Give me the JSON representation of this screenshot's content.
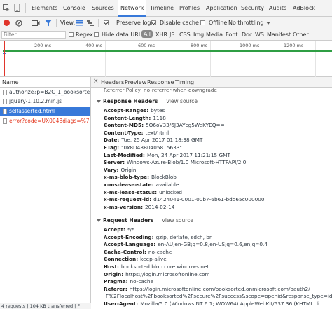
{
  "tabs": [
    {
      "label": "Elements"
    },
    {
      "label": "Console"
    },
    {
      "label": "Sources"
    },
    {
      "label": "Network"
    },
    {
      "label": "Timeline"
    },
    {
      "label": "Profiles"
    },
    {
      "label": "Application"
    },
    {
      "label": "Security"
    },
    {
      "label": "Audits"
    },
    {
      "label": "AdBlock"
    }
  ],
  "controls": {
    "view_label": "View:",
    "preserve_log": "Preserve log",
    "disable_cache": "Disable cache",
    "offline": "Offline",
    "throttling": "No throttling"
  },
  "filter": {
    "placeholder": "Filter",
    "regex": "Regex",
    "hide_data_urls": "Hide data URLs",
    "types": [
      "All",
      "XHR",
      "JS",
      "CSS",
      "Img",
      "Media",
      "Font",
      "Doc",
      "WS",
      "Manifest",
      "Other"
    ]
  },
  "timeline": {
    "ticks": [
      "200 ms",
      "400 ms",
      "600 ms",
      "800 ms",
      "1000 ms",
      "1200 ms"
    ]
  },
  "requests": {
    "header": "Name",
    "items": [
      {
        "name": "authorize?p=B2C_1_booksortedA..."
      },
      {
        "name": "jquery-1.10.2.min.js"
      },
      {
        "name": "selfasserted.html"
      },
      {
        "name": "error?code=UX0048diags=%7B%..."
      }
    ],
    "status": "4 requests | 104 KB transferred | F"
  },
  "detail_tabs": [
    "Headers",
    "Preview",
    "Response",
    "Timing"
  ],
  "referrer_line": "Referrer Policy: no-referrer-when-downgrade",
  "response_headers": {
    "title": "Response Headers",
    "view_source": "view source",
    "rows": [
      {
        "k": "Accept-Ranges:",
        "v": "bytes"
      },
      {
        "k": "Content-Length:",
        "v": "1118"
      },
      {
        "k": "Content-MD5:",
        "v": "5O6oV33/6J3AYcg5WeKYEQ=="
      },
      {
        "k": "Content-Type:",
        "v": "text/html"
      },
      {
        "k": "Date:",
        "v": "Tue, 25 Apr 2017 01:18:38 GMT"
      },
      {
        "k": "ETag:",
        "v": "\"0x8D48B0405815633\""
      },
      {
        "k": "Last-Modified:",
        "v": "Mon, 24 Apr 2017 11:21:15 GMT"
      },
      {
        "k": "Server:",
        "v": "Windows-Azure-Blob/1.0 Microsoft-HTTPAPI/2.0"
      },
      {
        "k": "Vary:",
        "v": "Origin"
      },
      {
        "k": "x-ms-blob-type:",
        "v": "BlockBlob"
      },
      {
        "k": "x-ms-lease-state:",
        "v": "available"
      },
      {
        "k": "x-ms-lease-status:",
        "v": "unlocked"
      },
      {
        "k": "x-ms-request-id:",
        "v": "d1424041-0001-00b7-6b61-bdd65c000000"
      },
      {
        "k": "x-ms-version:",
        "v": "2014-02-14"
      }
    ]
  },
  "request_headers": {
    "title": "Request Headers",
    "view_source": "view source",
    "rows": [
      {
        "k": "Accept:",
        "v": "*/*"
      },
      {
        "k": "Accept-Encoding:",
        "v": "gzip, deflate, sdch, br"
      },
      {
        "k": "Accept-Language:",
        "v": "en-AU,en-GB;q=0.8,en-US;q=0.6,en;q=0.4"
      },
      {
        "k": "Cache-Control:",
        "v": "no-cache"
      },
      {
        "k": "Connection:",
        "v": "keep-alive"
      },
      {
        "k": "Host:",
        "v": "booksorted.blob.core.windows.net"
      },
      {
        "k": "Origin:",
        "v": "https://login.microsoftonline.com"
      },
      {
        "k": "Pragma:",
        "v": "no-cache"
      },
      {
        "k": "Referer:",
        "v": "https://login.microsoftonline.com/booksorted.onmicrosoft.com/oauth2/"
      },
      {
        "k": "",
        "v": "F%2Flocalhost%2Fbooksorted%2Fsecure%2Fsuccess&scope=openid&response_type=id_t"
      },
      {
        "k": "User-Agent:",
        "v": "Mozilla/5.0 (Windows NT 6.1; WOW64) AppleWebKit/537.36 (KHTML, li"
      }
    ]
  },
  "colors": {
    "accent": "#3879d9",
    "selected_row": "#3879d9",
    "error_text": "#e3371e",
    "record": "#e0352b"
  }
}
